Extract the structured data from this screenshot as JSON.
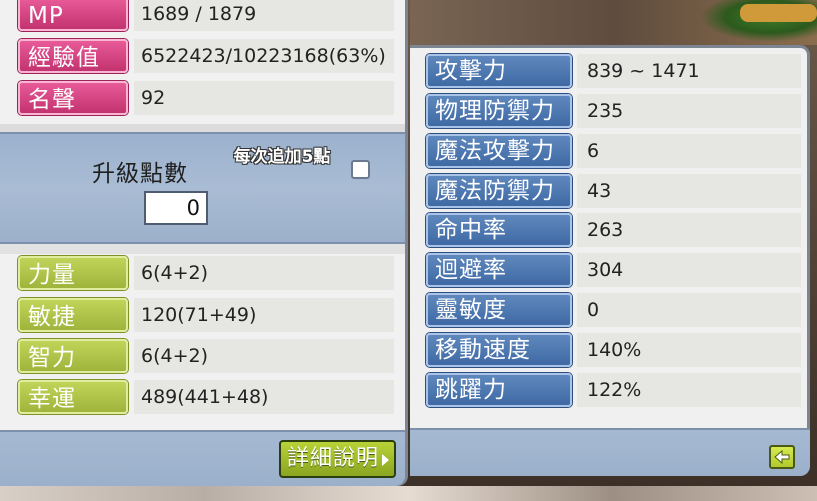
{
  "left_panel": {
    "rows": [
      {
        "label": "MP",
        "value": "1689 / 1879"
      },
      {
        "label": "經驗值",
        "value": "6522423/10223168(63%)"
      },
      {
        "label": "名聲",
        "value": "92"
      }
    ],
    "ability_points": {
      "label": "升級點數",
      "value": "0",
      "auto_add_label": "每次追加5點",
      "auto_add_checked": false
    },
    "stats": [
      {
        "label": "力量",
        "value": "6(4+2)"
      },
      {
        "label": "敏捷",
        "value": "120(71+49)"
      },
      {
        "label": "智力",
        "value": "6(4+2)"
      },
      {
        "label": "幸運",
        "value": "489(441+48)"
      }
    ],
    "detail_button_label": "詳細說明"
  },
  "right_panel": {
    "rows": [
      {
        "label": "攻擊力",
        "value": "839 ~ 1471"
      },
      {
        "label": "物理防禦力",
        "value": "235"
      },
      {
        "label": "魔法攻擊力",
        "value": "6"
      },
      {
        "label": "魔法防禦力",
        "value": "43"
      },
      {
        "label": "命中率",
        "value": "263"
      },
      {
        "label": "迴避率",
        "value": "304"
      },
      {
        "label": "靈敏度",
        "value": "0"
      },
      {
        "label": "移動速度",
        "value": "140%"
      },
      {
        "label": "跳躍力",
        "value": "122%"
      }
    ]
  },
  "colors": {
    "pink_label": "#c2336f",
    "green_label": "#9fb43b",
    "blue_label": "#3f6aa4",
    "panel_frame": "#9bb0ca"
  },
  "icons": {
    "detail_arrow": "chevron-right-icon",
    "back": "arrow-left-icon"
  }
}
